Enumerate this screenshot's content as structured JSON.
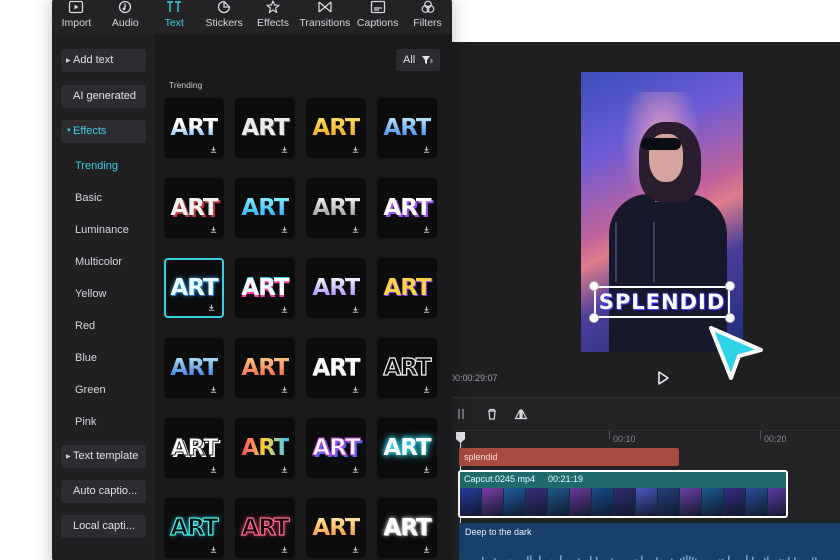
{
  "tabs": [
    {
      "label": "Import",
      "icon": "import-icon"
    },
    {
      "label": "Audio",
      "icon": "audio-icon"
    },
    {
      "label": "Text",
      "icon": "text-icon",
      "active": true
    },
    {
      "label": "Stickers",
      "icon": "stickers-icon"
    },
    {
      "label": "Effects",
      "icon": "effects-icon"
    },
    {
      "label": "Transitions",
      "icon": "transitions-icon"
    },
    {
      "label": "Captions",
      "icon": "captions-icon"
    },
    {
      "label": "Filters",
      "icon": "filters-icon"
    }
  ],
  "sidebar": {
    "add_text": "Add text",
    "ai_generated": "AI generated",
    "effects": "Effects",
    "effect_categories": [
      "Trending",
      "Basic",
      "Luminance",
      "Multicolor",
      "Yellow",
      "Red",
      "Blue",
      "Green",
      "Pink"
    ],
    "text_template": "Text template",
    "auto_captions": "Auto captio...",
    "local_captions": "Local capti..."
  },
  "content": {
    "filter_label": "All",
    "section_label": "Trending",
    "tile_text": "ART",
    "tile_count": 24,
    "selected_index": 8
  },
  "preview": {
    "overlay_text": "SPLENDID",
    "time": "00:00:29:07"
  },
  "timeline": {
    "ticks": [
      "00:10",
      "00:20"
    ],
    "text_clip": "splendid",
    "video_clip_name": "Capcut.0245 mp4",
    "video_clip_duration": "00:21:19",
    "audio_clip": "Deep to the dark"
  },
  "colors": {
    "accent": "#3ccfe2",
    "text_clip": "#a64b3e",
    "video_clip": "#1f6a6a",
    "audio_clip": "#19406b"
  }
}
